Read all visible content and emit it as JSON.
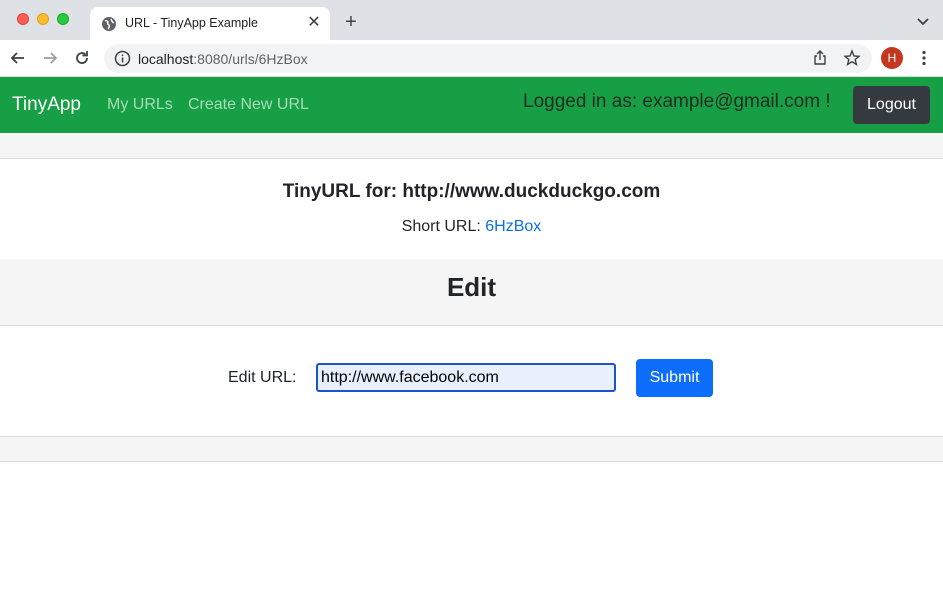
{
  "browser": {
    "tab_title": "URL - TinyApp Example",
    "url_host": "localhost",
    "url_rest": ":8080/urls/6HzBox",
    "profile_initial": "H",
    "icons": [
      "globe-icon",
      "close-icon",
      "plus-icon",
      "chevron-down-icon",
      "back-icon",
      "forward-icon",
      "reload-icon",
      "info-icon",
      "share-icon",
      "star-icon",
      "kebab-icon"
    ]
  },
  "navbar": {
    "brand": "TinyApp",
    "links": [
      "My URLs",
      "Create New URL"
    ],
    "logged_in": "Logged in as: example@gmail.com !",
    "logout_label": "Logout",
    "color": "#179f45"
  },
  "main": {
    "tinyurl_title": "TinyURL for: http://www.duckduckgo.com",
    "short_url_label": "Short URL:",
    "short_url_value": "6HzBox",
    "edit_heading": "Edit",
    "edit_label": "Edit URL:",
    "edit_value": "http://www.facebook.com",
    "submit_label": "Submit"
  }
}
